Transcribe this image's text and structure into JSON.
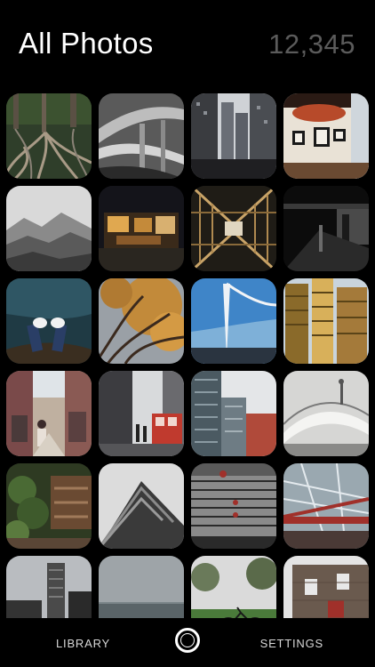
{
  "header": {
    "title": "All Photos",
    "count": "12,345"
  },
  "photos": [
    {
      "subject": "tree roots in forest",
      "colors": [
        "#2f3e2a",
        "#8a8276"
      ]
    },
    {
      "subject": "concrete highway interchange",
      "colors": [
        "#3a3a3a",
        "#9a9a9a"
      ]
    },
    {
      "subject": "narrow city street between towers",
      "colors": [
        "#5a5e66",
        "#1f1f22"
      ]
    },
    {
      "subject": "cafe interior with framed pictures",
      "colors": [
        "#b74a2a",
        "#e9e2d6"
      ]
    },
    {
      "subject": "misty mountain landscape",
      "colors": [
        "#cfcfcf",
        "#4a4a4a"
      ]
    },
    {
      "subject": "night market stall",
      "colors": [
        "#17171c",
        "#c48a3a"
      ]
    },
    {
      "subject": "bamboo scaffolding corridor",
      "colors": [
        "#2d2a20",
        "#c9a468"
      ]
    },
    {
      "subject": "dark covered walkway",
      "colors": [
        "#0e0e0e",
        "#6b6b6b"
      ]
    },
    {
      "subject": "feet over water",
      "colors": [
        "#1f3a44",
        "#4d7a8a"
      ]
    },
    {
      "subject": "autumn tree branches",
      "colors": [
        "#c28a3a",
        "#3b2a1e"
      ]
    },
    {
      "subject": "white spire and blue sky",
      "colors": [
        "#3f85c8",
        "#e9eef2"
      ]
    },
    {
      "subject": "tall yellow residential towers",
      "colors": [
        "#8a6a2a",
        "#d8b05a"
      ]
    },
    {
      "subject": "busy street market",
      "colors": [
        "#7a4a4a",
        "#bfb0a0"
      ]
    },
    {
      "subject": "street with red tram",
      "colors": [
        "#3c3c40",
        "#c03a2e"
      ]
    },
    {
      "subject": "glass buildings",
      "colors": [
        "#4b5a62",
        "#b04a3a"
      ]
    },
    {
      "subject": "white bridge under grey sky",
      "colors": [
        "#d6d6d4",
        "#7a7a7a"
      ]
    },
    {
      "subject": "plant shop with pots",
      "colors": [
        "#2e3a22",
        "#a07a5a"
      ]
    },
    {
      "subject": "angular building against sky",
      "colors": [
        "#dcdcdc",
        "#3a3a3a"
      ]
    },
    {
      "subject": "building facade with lanterns",
      "colors": [
        "#7c7c7c",
        "#2a2a2a"
      ]
    },
    {
      "subject": "glass canopy with red beams",
      "colors": [
        "#9aa8b0",
        "#a0302a"
      ]
    },
    {
      "subject": "city skyline with tower",
      "colors": [
        "#b9bcc0",
        "#333333"
      ]
    },
    {
      "subject": "calm sea and grey sky",
      "colors": [
        "#9ea4a8",
        "#5a6468"
      ]
    },
    {
      "subject": "park with bicycle",
      "colors": [
        "#dadada",
        "#4a7a3a"
      ]
    },
    {
      "subject": "stone house with red door",
      "colors": [
        "#6a5a4e",
        "#a0302a"
      ]
    }
  ],
  "tabbar": {
    "library_label": "LIBRARY",
    "settings_label": "SETTINGS",
    "shutter_icon": "shutter-circle-icon"
  }
}
